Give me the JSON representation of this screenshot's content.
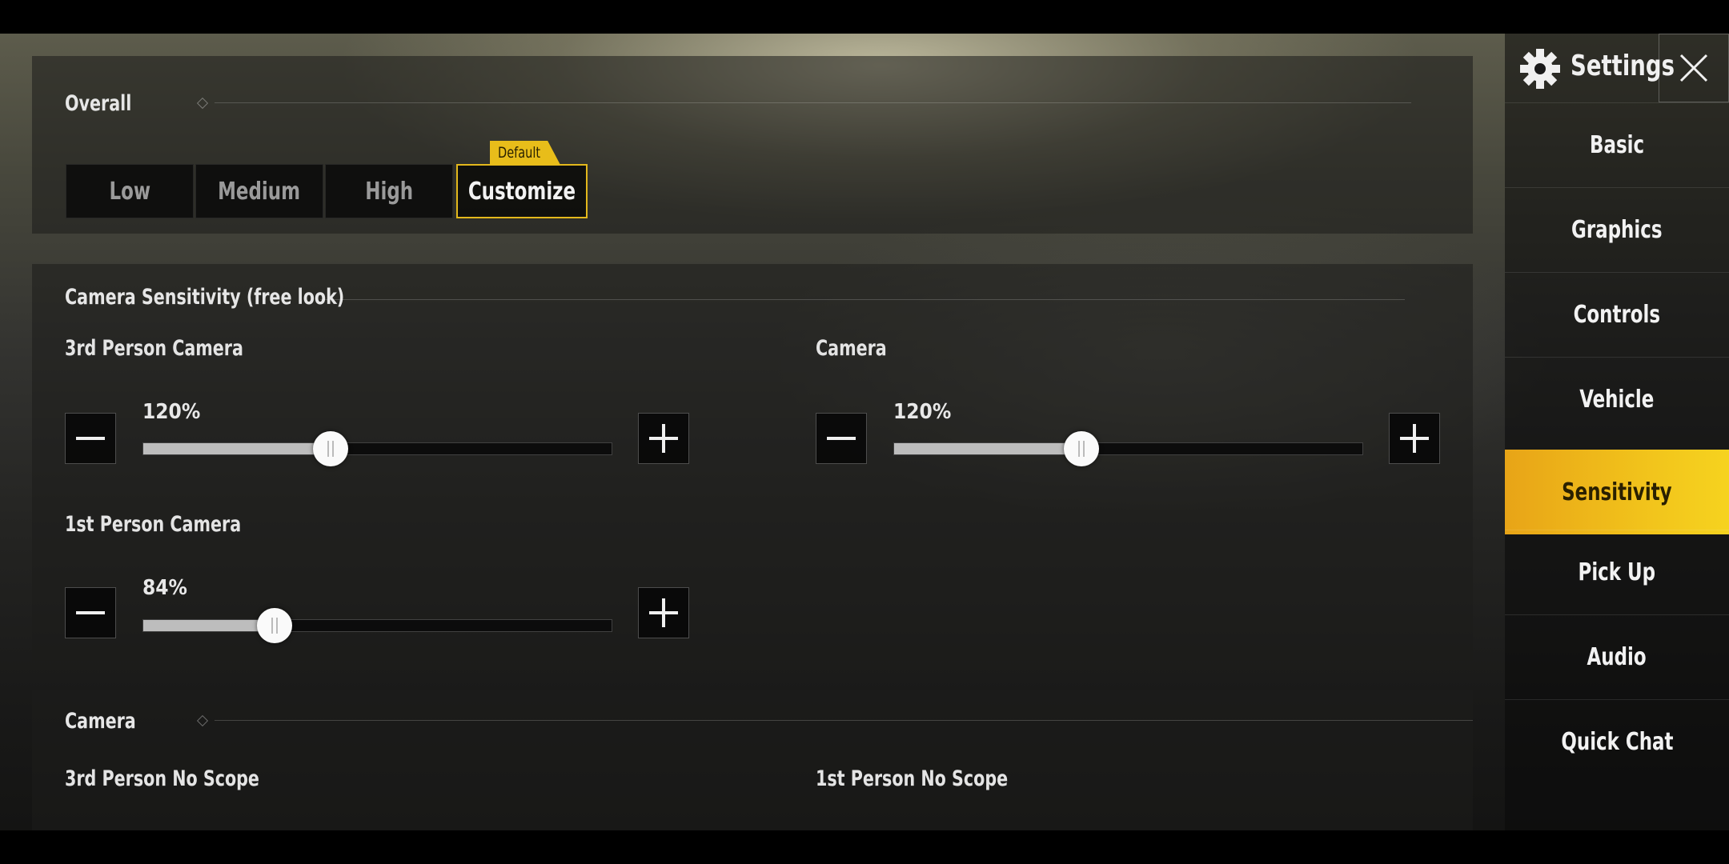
{
  "header": {
    "settings_title": "Settings"
  },
  "overall": {
    "title": "Overall",
    "default_tag": "Default",
    "options": [
      "Low",
      "Medium",
      "High",
      "Customize"
    ],
    "selected": "Customize"
  },
  "camera_sensitivity": {
    "title": "Camera Sensitivity (free look)",
    "third_person": {
      "label": "3rd Person Camera",
      "value_text": "120%",
      "fraction": 0.4
    },
    "camera": {
      "label": "Camera",
      "value_text": "120%",
      "fraction": 0.4
    },
    "first_person": {
      "label": "1st Person Camera",
      "value_text": "84%",
      "fraction": 0.28
    }
  },
  "camera_section": {
    "title": "Camera",
    "third_person_no_scope": "3rd Person No Scope",
    "first_person_no_scope": "1st Person No Scope"
  },
  "sidebar": {
    "items": [
      "Basic",
      "Graphics",
      "Controls",
      "Vehicle",
      "Sensitivity",
      "Pick Up",
      "Audio",
      "Quick Chat"
    ],
    "active": "Sensitivity"
  },
  "colors": {
    "accent": "#f0bd1b",
    "panel": "#1c1c1a"
  }
}
